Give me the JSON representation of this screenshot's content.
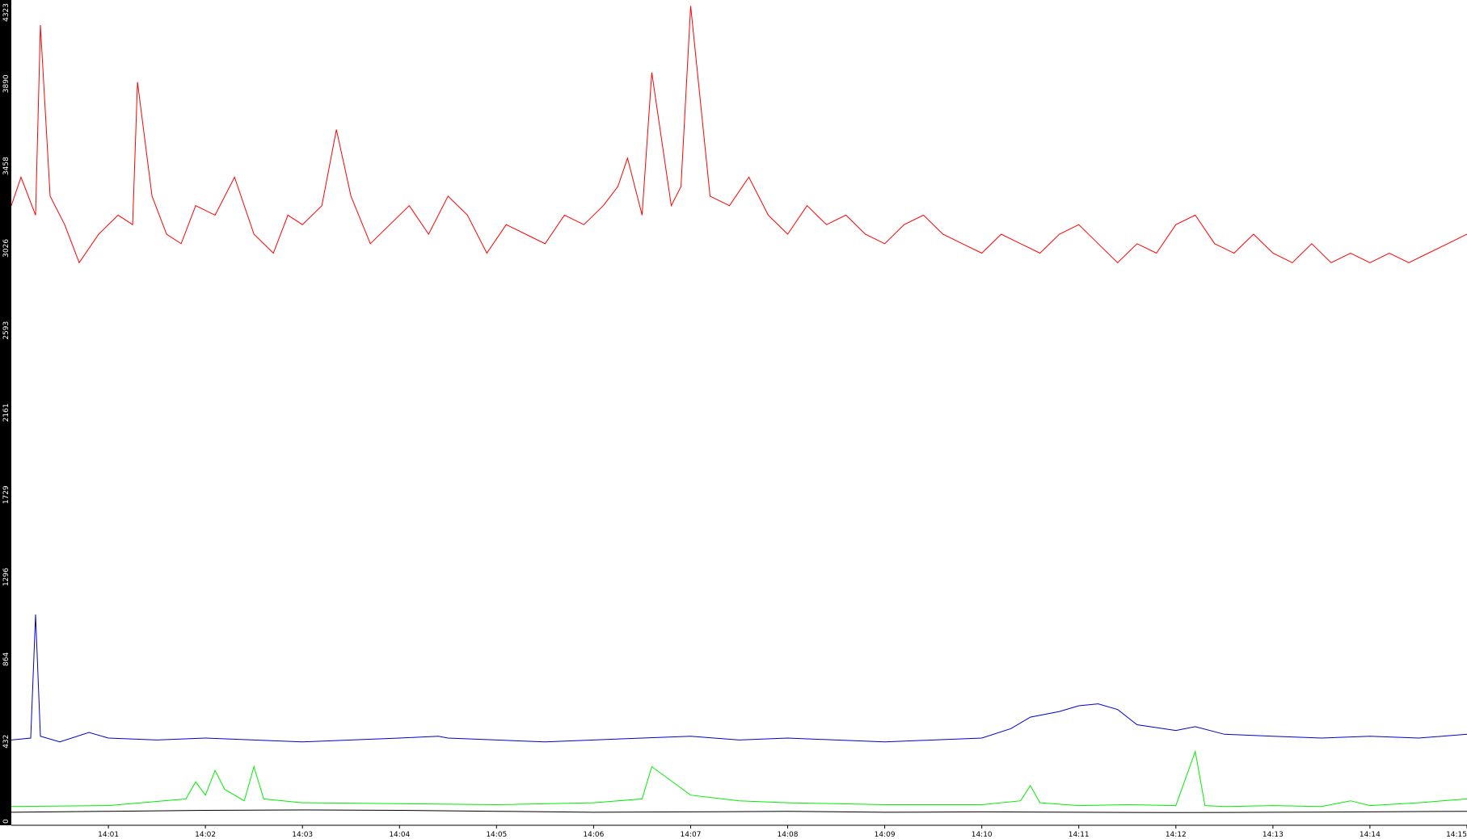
{
  "chart_data": {
    "type": "line",
    "title": "",
    "xlabel": "",
    "ylabel": "",
    "ylim": [
      0,
      4323
    ],
    "y_ticks": [
      "0",
      "432",
      "864",
      "1296",
      "1729",
      "2161",
      "2593",
      "3026",
      "3458",
      "3890",
      "4323"
    ],
    "x_ticks": [
      {
        "t": 1.0,
        "label": "14:01"
      },
      {
        "t": 2.0,
        "label": "14:02"
      },
      {
        "t": 3.0,
        "label": "14:03"
      },
      {
        "t": 4.0,
        "label": "14:04"
      },
      {
        "t": 5.0,
        "label": "14:05"
      },
      {
        "t": 6.0,
        "label": "14:06"
      },
      {
        "t": 7.0,
        "label": "14:07"
      },
      {
        "t": 8.0,
        "label": "14:08"
      },
      {
        "t": 9.0,
        "label": "14:09"
      },
      {
        "t": 10.0,
        "label": "14:10"
      },
      {
        "t": 11.0,
        "label": "14:11"
      },
      {
        "t": 12.0,
        "label": "14:12"
      },
      {
        "t": 13.0,
        "label": "14:13"
      },
      {
        "t": 14.0,
        "label": "14:14"
      },
      {
        "t": 15.0,
        "label": "14:15"
      }
    ],
    "xlim": [
      0.0,
      15.0
    ],
    "grid": false,
    "series": [
      {
        "color": "#ff0000",
        "x": [
          0.0,
          0.1,
          0.25,
          0.3,
          0.4,
          0.55,
          0.7,
          0.9,
          1.1,
          1.25,
          1.3,
          1.45,
          1.6,
          1.75,
          1.9,
          2.1,
          2.3,
          2.5,
          2.7,
          2.85,
          3.0,
          3.2,
          3.35,
          3.5,
          3.7,
          3.9,
          4.1,
          4.3,
          4.5,
          4.7,
          4.9,
          5.1,
          5.3,
          5.5,
          5.7,
          5.9,
          6.1,
          6.25,
          6.35,
          6.5,
          6.6,
          6.8,
          6.9,
          7.0,
          7.2,
          7.4,
          7.6,
          7.8,
          8.0,
          8.2,
          8.4,
          8.6,
          8.8,
          9.0,
          9.2,
          9.4,
          9.6,
          9.8,
          10.0,
          10.2,
          10.4,
          10.6,
          10.8,
          11.0,
          11.2,
          11.4,
          11.6,
          11.8,
          12.0,
          12.2,
          12.4,
          12.6,
          12.8,
          13.0,
          13.2,
          13.4,
          13.6,
          13.8,
          14.0,
          14.2,
          14.4,
          14.6,
          14.8,
          15.0
        ],
        "values": [
          3250,
          3400,
          3200,
          4200,
          3300,
          3150,
          2950,
          3100,
          3200,
          3150,
          3900,
          3300,
          3100,
          3050,
          3250,
          3200,
          3400,
          3100,
          3000,
          3200,
          3150,
          3250,
          3650,
          3300,
          3050,
          3150,
          3250,
          3100,
          3300,
          3200,
          3000,
          3150,
          3100,
          3050,
          3200,
          3150,
          3250,
          3350,
          3500,
          3200,
          3950,
          3250,
          3350,
          4300,
          3300,
          3250,
          3400,
          3200,
          3100,
          3250,
          3150,
          3200,
          3100,
          3050,
          3150,
          3200,
          3100,
          3050,
          3000,
          3100,
          3050,
          3000,
          3100,
          3150,
          3050,
          2950,
          3050,
          3000,
          3150,
          3200,
          3050,
          3000,
          3100,
          3000,
          2950,
          3050,
          2950,
          3000,
          2950,
          3000,
          2950,
          3000,
          3050,
          3100
        ]
      },
      {
        "color": "#0000cc",
        "x": [
          0.0,
          0.2,
          0.25,
          0.3,
          0.5,
          0.8,
          1.0,
          1.5,
          2.0,
          2.5,
          3.0,
          3.5,
          4.0,
          4.4,
          4.5,
          5.0,
          5.5,
          6.0,
          6.5,
          7.0,
          7.5,
          8.0,
          8.5,
          9.0,
          9.5,
          10.0,
          10.3,
          10.5,
          10.8,
          11.0,
          11.2,
          11.4,
          11.6,
          12.0,
          12.2,
          12.5,
          13.0,
          13.5,
          14.0,
          14.5,
          15.0
        ],
        "values": [
          440,
          450,
          1100,
          460,
          430,
          480,
          450,
          440,
          450,
          440,
          430,
          440,
          450,
          460,
          450,
          440,
          430,
          440,
          450,
          460,
          440,
          450,
          440,
          430,
          440,
          450,
          500,
          560,
          590,
          620,
          630,
          600,
          520,
          490,
          510,
          470,
          460,
          450,
          460,
          450,
          470
        ]
      },
      {
        "color": "#00ee00",
        "x": [
          0.0,
          1.0,
          1.8,
          1.9,
          2.0,
          2.1,
          2.2,
          2.4,
          2.5,
          2.6,
          3.0,
          4.0,
          5.0,
          6.0,
          6.5,
          6.6,
          7.0,
          7.5,
          8.0,
          9.0,
          10.0,
          10.4,
          10.5,
          10.6,
          11.0,
          11.5,
          12.0,
          12.2,
          12.3,
          12.5,
          13.0,
          13.5,
          13.8,
          14.0,
          14.5,
          15.0
        ],
        "values": [
          90,
          95,
          130,
          220,
          150,
          280,
          180,
          120,
          300,
          130,
          110,
          105,
          100,
          110,
          130,
          300,
          150,
          120,
          110,
          100,
          100,
          120,
          200,
          110,
          95,
          100,
          95,
          380,
          95,
          90,
          95,
          90,
          120,
          95,
          110,
          130
        ]
      },
      {
        "color": "#000000",
        "x": [
          0.0,
          1.0,
          2.0,
          3.0,
          4.0,
          5.0,
          6.0,
          7.0,
          8.0,
          9.0,
          10.0,
          11.0,
          12.0,
          13.0,
          14.0,
          15.0
        ],
        "values": [
          60,
          65,
          70,
          72,
          70,
          65,
          60,
          62,
          65,
          60,
          62,
          60,
          58,
          60,
          62,
          65
        ]
      }
    ]
  }
}
